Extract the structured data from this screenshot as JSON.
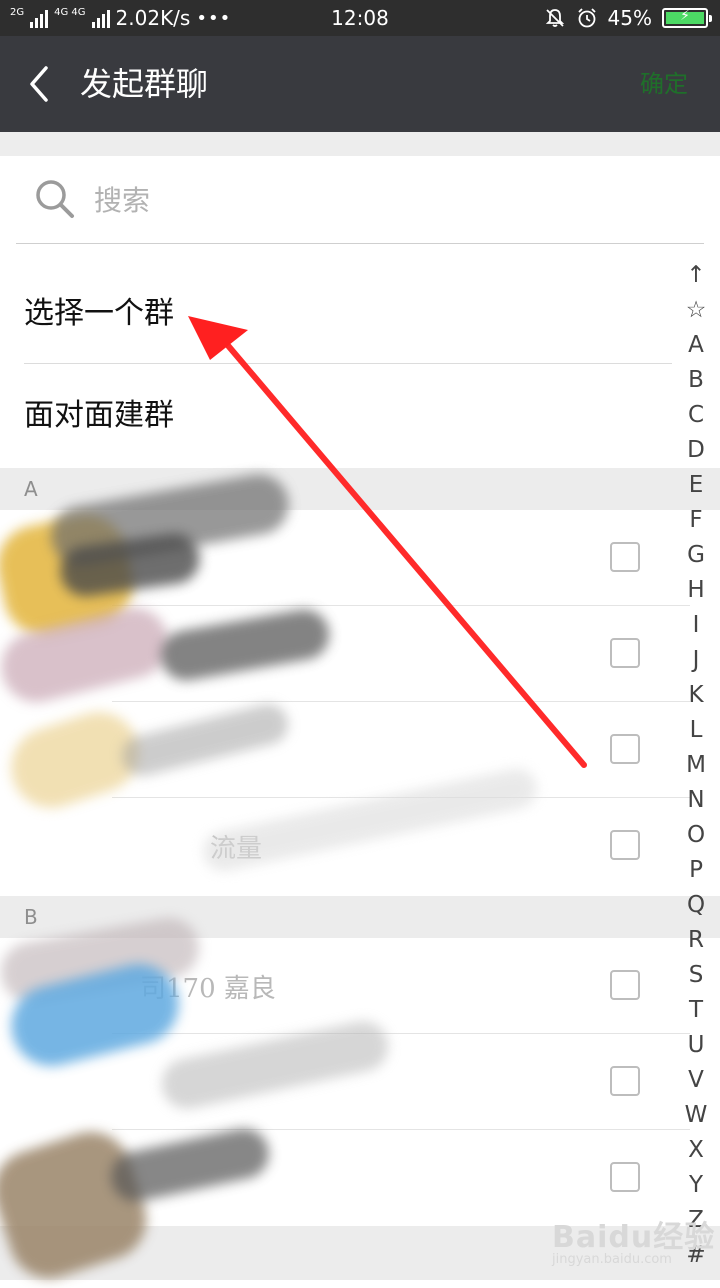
{
  "status_bar": {
    "net1": "2G",
    "net2": "4G 4G",
    "speed": "2.02K/s",
    "dots": "•••",
    "time": "12:08",
    "battery": "45%"
  },
  "header": {
    "title": "发起群聊",
    "confirm_label": "确定"
  },
  "search": {
    "placeholder": "搜索"
  },
  "options": {
    "select_group": "选择一个群",
    "face_to_face": "面对面建群"
  },
  "sections": [
    {
      "letter": "A"
    },
    {
      "letter": "B"
    }
  ],
  "contacts_visible": {
    "a4_partial": "流量",
    "b1_partial": "司170",
    "b1_suffix": "嘉良"
  },
  "index": [
    "↑",
    "☆",
    "A",
    "B",
    "C",
    "D",
    "E",
    "F",
    "G",
    "H",
    "I",
    "J",
    "K",
    "L",
    "M",
    "N",
    "O",
    "P",
    "Q",
    "R",
    "S",
    "T",
    "U",
    "V",
    "W",
    "X",
    "Y",
    "Z",
    "#"
  ],
  "watermark": {
    "main": "Baidu经验",
    "sub": "jingyan.baidu.com"
  },
  "colors": {
    "header_bg": "#393a3f",
    "confirm_disabled": "#1f6f2a",
    "arrow": "#ff2020"
  }
}
